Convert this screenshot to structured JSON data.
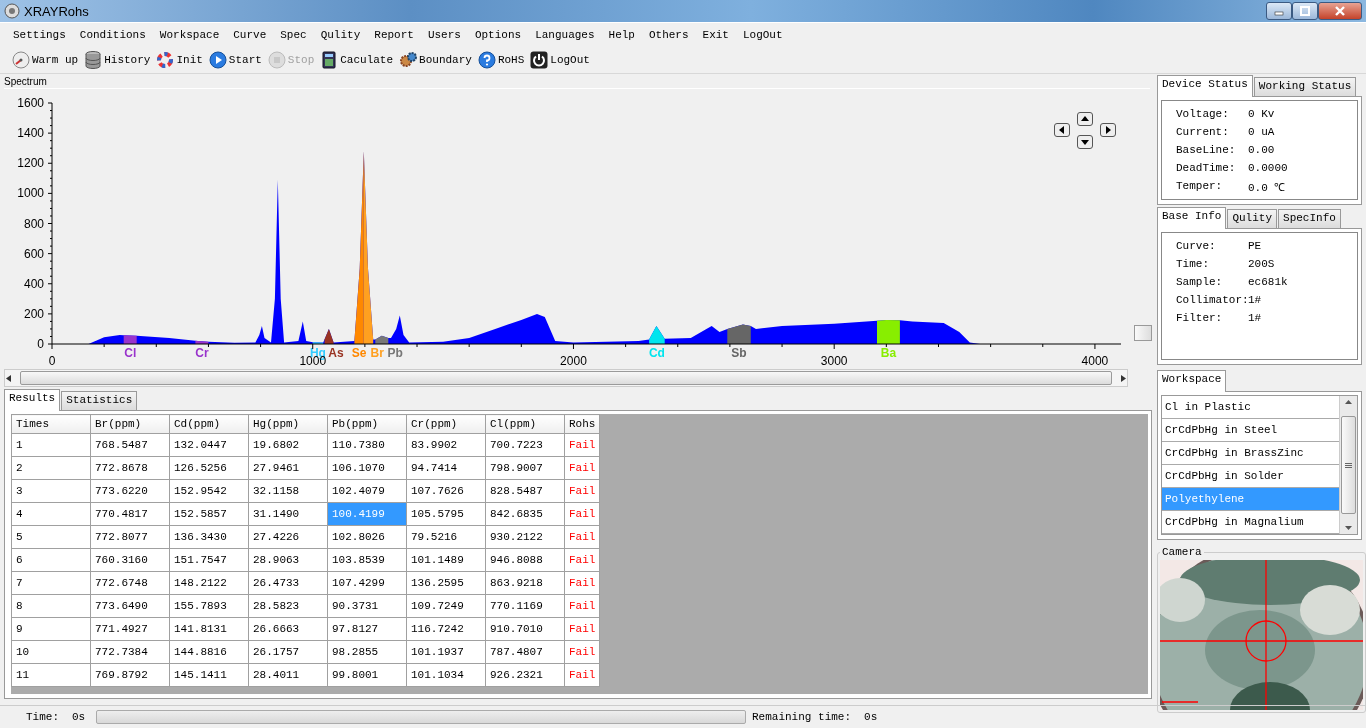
{
  "window": {
    "title": "XRAYRohs"
  },
  "menu": [
    "Settings",
    "Conditions",
    "Workspace",
    "Curve",
    "Spec",
    "Qulity",
    "Report",
    "Users",
    "Options",
    "Languages",
    "Help",
    "Others",
    "Exit",
    "LogOut"
  ],
  "toolbar": [
    {
      "label": "Warm up",
      "disabled": false
    },
    {
      "label": "History",
      "disabled": false
    },
    {
      "label": "Init",
      "disabled": false
    },
    {
      "label": "Start",
      "disabled": false
    },
    {
      "label": "Stop",
      "disabled": true
    },
    {
      "label": "Caculate",
      "disabled": false
    },
    {
      "label": "Boundary",
      "disabled": false
    },
    {
      "label": "RoHS",
      "disabled": false
    },
    {
      "label": "LogOut",
      "disabled": false
    }
  ],
  "spectrum": {
    "title": "Spectrum",
    "chart_data": {
      "type": "area",
      "x": [
        100,
        140,
        200,
        260,
        275,
        325,
        450,
        550,
        560,
        600,
        700,
        780,
        795,
        805,
        815,
        840,
        855,
        866,
        877,
        890,
        945,
        962,
        975,
        1000,
        1040,
        1045,
        1062,
        1080,
        1160,
        1180,
        1196,
        1212,
        1232,
        1240,
        1265,
        1290,
        1300,
        1320,
        1334,
        1348,
        1370,
        1500,
        1600,
        1700,
        1800,
        1860,
        1890,
        1930,
        2000,
        2250,
        2290,
        2318,
        2350,
        2450,
        2510,
        2530,
        2560,
        2590,
        2620,
        2650,
        2680,
        2700,
        2800,
        3000,
        3164,
        3200,
        3252,
        3300,
        3420,
        3480,
        3520,
        3560,
        4100
      ],
      "series": [
        {
          "color": "#0000ff",
          "values": [
            0,
            0,
            45,
            60,
            58,
            55,
            40,
            22,
            20,
            15,
            8,
            10,
            60,
            120,
            40,
            10,
            300,
            1090,
            300,
            10,
            20,
            150,
            20,
            12,
            10,
            30,
            100,
            10,
            20,
            500,
            1280,
            500,
            30,
            30,
            55,
            40,
            40,
            100,
            190,
            60,
            10,
            15,
            40,
            100,
            160,
            200,
            180,
            20,
            10,
            20,
            30,
            120,
            35,
            40,
            100,
            120,
            80,
            100,
            115,
            130,
            120,
            100,
            120,
            135,
            155,
            160,
            158,
            150,
            140,
            80,
            10,
            0,
            0
          ]
        },
        {
          "name": "Cl",
          "color": "#9933cc",
          "values": [
            null,
            null,
            null,
            null,
            58,
            55,
            null,
            null,
            null,
            null,
            null,
            null,
            null,
            null,
            null,
            null,
            null,
            null,
            null,
            null,
            null,
            null,
            null,
            null,
            null,
            null,
            null,
            null,
            null,
            null,
            null,
            null,
            null,
            null,
            null,
            null,
            null,
            null,
            null,
            null,
            null,
            null,
            null,
            null,
            null,
            null,
            null,
            null,
            null,
            null,
            null,
            null,
            null,
            null,
            null,
            null,
            null,
            null,
            null,
            null,
            null,
            null,
            null,
            null,
            null,
            null,
            null,
            null,
            null,
            null,
            null,
            null,
            null
          ]
        },
        {
          "name": "Cr",
          "color": "#9933cc",
          "values": [
            null,
            null,
            null,
            null,
            null,
            null,
            null,
            22,
            20,
            15,
            null,
            null,
            null,
            null,
            null,
            null,
            null,
            null,
            null,
            null,
            null,
            null,
            null,
            null,
            null,
            null,
            null,
            null,
            null,
            null,
            null,
            null,
            null,
            null,
            null,
            null,
            null,
            null,
            null,
            null,
            null,
            null,
            null,
            null,
            null,
            null,
            null,
            null,
            null,
            null,
            null,
            null,
            null,
            null,
            null,
            null,
            null,
            null,
            null,
            null,
            null,
            null,
            null,
            null,
            null,
            null,
            null,
            null,
            null,
            null,
            null,
            null,
            null
          ]
        },
        {
          "name": "Hg",
          "color": "#33ccff",
          "values": [
            null,
            null,
            null,
            null,
            null,
            null,
            null,
            null,
            null,
            null,
            null,
            null,
            null,
            null,
            null,
            null,
            null,
            null,
            null,
            null,
            null,
            null,
            null,
            12,
            10,
            null,
            null,
            null,
            null,
            null,
            null,
            null,
            null,
            null,
            null,
            null,
            null,
            null,
            null,
            null,
            null,
            null,
            null,
            null,
            null,
            null,
            null,
            null,
            null,
            null,
            null,
            null,
            null,
            null,
            null,
            null,
            null,
            null,
            null,
            null,
            null,
            null,
            null,
            null,
            null,
            null,
            null,
            null,
            null,
            null,
            null,
            null,
            null
          ]
        },
        {
          "name": "As",
          "color": "#993322",
          "values": [
            null,
            null,
            null,
            null,
            null,
            null,
            null,
            null,
            null,
            null,
            null,
            null,
            null,
            null,
            null,
            null,
            null,
            null,
            null,
            null,
            null,
            null,
            null,
            null,
            null,
            30,
            100,
            10,
            null,
            null,
            null,
            null,
            null,
            null,
            null,
            null,
            null,
            null,
            null,
            null,
            null,
            null,
            null,
            null,
            null,
            null,
            null,
            null,
            null,
            null,
            null,
            null,
            null,
            null,
            null,
            null,
            null,
            null,
            null,
            null,
            null,
            null,
            null,
            null,
            null,
            null,
            null,
            null,
            null,
            null,
            null,
            null,
            null
          ]
        },
        {
          "name": "Se",
          "color": "#ff8800",
          "values": [
            null,
            null,
            null,
            null,
            null,
            null,
            null,
            null,
            null,
            null,
            null,
            null,
            null,
            null,
            null,
            null,
            null,
            null,
            null,
            null,
            null,
            null,
            null,
            null,
            null,
            null,
            null,
            null,
            20,
            500,
            1280,
            null,
            null,
            null,
            null,
            null,
            null,
            null,
            null,
            null,
            null,
            null,
            null,
            null,
            null,
            null,
            null,
            null,
            null,
            null,
            null,
            null,
            null,
            null,
            null,
            null,
            null,
            null,
            null,
            null,
            null,
            null,
            null,
            null,
            null,
            null,
            null,
            null,
            null,
            null,
            null,
            null,
            null
          ]
        },
        {
          "name": "Br",
          "color": "#ffa020",
          "values": [
            null,
            null,
            null,
            null,
            null,
            null,
            null,
            null,
            null,
            null,
            null,
            null,
            null,
            null,
            null,
            null,
            null,
            null,
            null,
            null,
            null,
            null,
            null,
            null,
            null,
            null,
            null,
            null,
            null,
            null,
            1280,
            500,
            30,
            null,
            null,
            null,
            null,
            null,
            null,
            null,
            null,
            null,
            null,
            null,
            null,
            null,
            null,
            null,
            null,
            null,
            null,
            null,
            null,
            null,
            null,
            null,
            null,
            null,
            null,
            null,
            null,
            null,
            null,
            null,
            null,
            null,
            null,
            null,
            null,
            null,
            null,
            null,
            null
          ]
        },
        {
          "name": "Pb",
          "color": "#777777",
          "values": [
            null,
            null,
            null,
            null,
            null,
            null,
            null,
            null,
            null,
            null,
            null,
            null,
            null,
            null,
            null,
            null,
            null,
            null,
            null,
            null,
            null,
            null,
            null,
            null,
            null,
            null,
            null,
            null,
            null,
            null,
            null,
            null,
            null,
            30,
            55,
            40,
            null,
            null,
            null,
            null,
            null,
            null,
            null,
            null,
            null,
            null,
            null,
            null,
            null,
            null,
            null,
            null,
            null,
            null,
            null,
            null,
            null,
            null,
            null,
            null,
            null,
            null,
            null,
            null,
            null,
            null,
            null,
            null,
            null,
            null,
            null,
            null,
            null
          ]
        },
        {
          "name": "Cd",
          "color": "#00e5ee",
          "values": [
            null,
            null,
            null,
            null,
            null,
            null,
            null,
            null,
            null,
            null,
            null,
            null,
            null,
            null,
            null,
            null,
            null,
            null,
            null,
            null,
            null,
            null,
            null,
            null,
            null,
            null,
            null,
            null,
            null,
            null,
            null,
            null,
            null,
            null,
            null,
            null,
            null,
            null,
            null,
            null,
            null,
            null,
            null,
            null,
            null,
            null,
            null,
            null,
            null,
            null,
            30,
            120,
            35,
            null,
            null,
            null,
            null,
            null,
            null,
            null,
            null,
            null,
            null,
            null,
            null,
            null,
            null,
            null,
            null,
            null,
            null,
            null,
            null
          ]
        },
        {
          "name": "Sb",
          "color": "#666666",
          "values": [
            null,
            null,
            null,
            null,
            null,
            null,
            null,
            null,
            null,
            null,
            null,
            null,
            null,
            null,
            null,
            null,
            null,
            null,
            null,
            null,
            null,
            null,
            null,
            null,
            null,
            null,
            null,
            null,
            null,
            null,
            null,
            null,
            null,
            null,
            null,
            null,
            null,
            null,
            null,
            null,
            null,
            null,
            null,
            null,
            null,
            null,
            null,
            null,
            null,
            null,
            null,
            null,
            null,
            null,
            null,
            null,
            null,
            100,
            115,
            130,
            120,
            null,
            null,
            null,
            null,
            null,
            null,
            null,
            null,
            null,
            null,
            null,
            null
          ]
        },
        {
          "name": "Ba",
          "color": "#88ee00",
          "values": [
            null,
            null,
            null,
            null,
            null,
            null,
            null,
            null,
            null,
            null,
            null,
            null,
            null,
            null,
            null,
            null,
            null,
            null,
            null,
            null,
            null,
            null,
            null,
            null,
            null,
            null,
            null,
            null,
            null,
            null,
            null,
            null,
            null,
            null,
            null,
            null,
            null,
            null,
            null,
            null,
            null,
            null,
            null,
            null,
            null,
            null,
            null,
            null,
            null,
            null,
            null,
            null,
            null,
            null,
            null,
            null,
            null,
            null,
            null,
            null,
            null,
            null,
            null,
            null,
            155,
            160,
            158,
            null,
            null,
            null,
            null,
            null,
            null
          ]
        }
      ],
      "xlim": [
        0,
        4100
      ],
      "ylim": [
        0,
        1600
      ],
      "xticks": [
        0,
        1000,
        2000,
        3000,
        4000
      ],
      "yticks": [
        0,
        200,
        400,
        600,
        800,
        1000,
        1200,
        1400,
        1600
      ]
    }
  },
  "result_tabs": [
    {
      "label": "Results",
      "selected": true
    },
    {
      "label": "Statistics",
      "selected": false
    }
  ],
  "table": {
    "columns": [
      "Times",
      "Br(ppm)",
      "Cd(ppm)",
      "Hg(ppm)",
      "Pb(ppm)",
      "Cr(ppm)",
      "Cl(ppm)",
      "Rohs"
    ],
    "rows": [
      [
        {
          "text": "1",
          "selected": false
        },
        {
          "text": "768.5487",
          "selected": false
        },
        {
          "text": "132.0447",
          "selected": false
        },
        {
          "text": "19.6802",
          "selected": false
        },
        {
          "text": "110.7380",
          "selected": false
        },
        {
          "text": "83.9902",
          "selected": false
        },
        {
          "text": "700.7223",
          "selected": false
        },
        {
          "text": "Fail",
          "selected": false
        }
      ],
      [
        {
          "text": "2",
          "selected": false
        },
        {
          "text": "772.8678",
          "selected": false
        },
        {
          "text": "126.5256",
          "selected": false
        },
        {
          "text": "27.9461",
          "selected": false
        },
        {
          "text": "106.1070",
          "selected": false
        },
        {
          "text": "94.7414",
          "selected": false
        },
        {
          "text": "798.9007",
          "selected": false
        },
        {
          "text": "Fail",
          "selected": false
        }
      ],
      [
        {
          "text": "3",
          "selected": false
        },
        {
          "text": "773.6220",
          "selected": false
        },
        {
          "text": "152.9542",
          "selected": false
        },
        {
          "text": "32.1158",
          "selected": false
        },
        {
          "text": "102.4079",
          "selected": false
        },
        {
          "text": "107.7626",
          "selected": false
        },
        {
          "text": "828.5487",
          "selected": false
        },
        {
          "text": "Fail",
          "selected": false
        }
      ],
      [
        {
          "text": "4",
          "selected": false
        },
        {
          "text": "770.4817",
          "selected": false
        },
        {
          "text": "152.5857",
          "selected": false
        },
        {
          "text": "31.1490",
          "selected": false
        },
        {
          "text": "100.4199",
          "selected": true
        },
        {
          "text": "105.5795",
          "selected": false
        },
        {
          "text": "842.6835",
          "selected": false
        },
        {
          "text": "Fail",
          "selected": false
        }
      ],
      [
        {
          "text": "5",
          "selected": false
        },
        {
          "text": "772.8077",
          "selected": false
        },
        {
          "text": "136.3430",
          "selected": false
        },
        {
          "text": "27.4226",
          "selected": false
        },
        {
          "text": "102.8026",
          "selected": false
        },
        {
          "text": "79.5216",
          "selected": false
        },
        {
          "text": "930.2122",
          "selected": false
        },
        {
          "text": "Fail",
          "selected": false
        }
      ],
      [
        {
          "text": "6",
          "selected": false
        },
        {
          "text": "760.3160",
          "selected": false
        },
        {
          "text": "151.7547",
          "selected": false
        },
        {
          "text": "28.9063",
          "selected": false
        },
        {
          "text": "103.8539",
          "selected": false
        },
        {
          "text": "101.1489",
          "selected": false
        },
        {
          "text": "946.8088",
          "selected": false
        },
        {
          "text": "Fail",
          "selected": false
        }
      ],
      [
        {
          "text": "7",
          "selected": false
        },
        {
          "text": "772.6748",
          "selected": false
        },
        {
          "text": "148.2122",
          "selected": false
        },
        {
          "text": "26.4733",
          "selected": false
        },
        {
          "text": "107.4299",
          "selected": false
        },
        {
          "text": "136.2595",
          "selected": false
        },
        {
          "text": "863.9218",
          "selected": false
        },
        {
          "text": "Fail",
          "selected": false
        }
      ],
      [
        {
          "text": "8",
          "selected": false
        },
        {
          "text": "773.6490",
          "selected": false
        },
        {
          "text": "155.7893",
          "selected": false
        },
        {
          "text": "28.5823",
          "selected": false
        },
        {
          "text": "90.3731",
          "selected": false
        },
        {
          "text": "109.7249",
          "selected": false
        },
        {
          "text": "770.1169",
          "selected": false
        },
        {
          "text": "Fail",
          "selected": false
        }
      ],
      [
        {
          "text": "9",
          "selected": false
        },
        {
          "text": "771.4927",
          "selected": false
        },
        {
          "text": "141.8131",
          "selected": false
        },
        {
          "text": "26.6663",
          "selected": false
        },
        {
          "text": "97.8127",
          "selected": false
        },
        {
          "text": "116.7242",
          "selected": false
        },
        {
          "text": "910.7010",
          "selected": false
        },
        {
          "text": "Fail",
          "selected": false
        }
      ],
      [
        {
          "text": "10",
          "selected": false
        },
        {
          "text": "772.7384",
          "selected": false
        },
        {
          "text": "144.8816",
          "selected": false
        },
        {
          "text": "26.1757",
          "selected": false
        },
        {
          "text": "98.2855",
          "selected": false
        },
        {
          "text": "101.1937",
          "selected": false
        },
        {
          "text": "787.4807",
          "selected": false
        },
        {
          "text": "Fail",
          "selected": false
        }
      ],
      [
        {
          "text": "11",
          "selected": false
        },
        {
          "text": "769.8792",
          "selected": false
        },
        {
          "text": "145.1411",
          "selected": false
        },
        {
          "text": "28.4011",
          "selected": false
        },
        {
          "text": "99.8001",
          "selected": false
        },
        {
          "text": "101.1034",
          "selected": false
        },
        {
          "text": "926.2321",
          "selected": false
        },
        {
          "text": "Fail",
          "selected": false
        }
      ]
    ]
  },
  "status_tabs": [
    {
      "label": "Device Status",
      "selected": true
    },
    {
      "label": "Working Status",
      "selected": false
    }
  ],
  "device_status": [
    {
      "label": "Voltage:",
      "value": "0 Kv"
    },
    {
      "label": "Current:",
      "value": "0 uA"
    },
    {
      "label": "BaseLine:",
      "value": "0.00"
    },
    {
      "label": "DeadTime:",
      "value": "0.0000"
    },
    {
      "label": "Temper:",
      "value": "0.0 ℃"
    }
  ],
  "info_tabs": [
    {
      "label": "Base Info",
      "selected": true
    },
    {
      "label": "Qulity",
      "selected": false
    },
    {
      "label": "SpecInfo",
      "selected": false
    }
  ],
  "base_info": [
    {
      "label": "Curve:",
      "value": "PE"
    },
    {
      "label": "Time:",
      "value": "200S"
    },
    {
      "label": "Sample:",
      "value": "ec681k"
    },
    {
      "label": "Collimator:",
      "value": "1#"
    },
    {
      "label": "Filter:",
      "value": "1#"
    }
  ],
  "workspace_tabs": [
    {
      "label": "Workspace",
      "selected": true
    }
  ],
  "workspace_list": [
    {
      "label": "Cl in Plastic",
      "selected": false
    },
    {
      "label": "CrCdPbHg in Steel",
      "selected": false
    },
    {
      "label": "CrCdPbHg in BrassZinc",
      "selected": false
    },
    {
      "label": "CrCdPbHg in Solder",
      "selected": false
    },
    {
      "label": "Polyethylene",
      "selected": true
    },
    {
      "label": "CrCdPbHg in Magnalium",
      "selected": false
    }
  ],
  "camera": {
    "title": "Camera",
    "kind": "picture"
  },
  "status_bar": {
    "time_label": "Time:",
    "time": "0s",
    "level": 0,
    "remaining_label": "Remaining time:",
    "remaining": "0s"
  }
}
